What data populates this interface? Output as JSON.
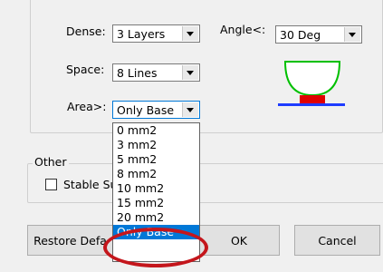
{
  "settings": {
    "dense": {
      "label": "Dense:",
      "value": "3 Layers"
    },
    "angle": {
      "label": "Angle<:",
      "value": "30 Deg"
    },
    "space": {
      "label": "Space:",
      "value": "8 Lines"
    },
    "area": {
      "label": "Area>:",
      "value": "Only Base"
    }
  },
  "area_dropdown": {
    "options": [
      "0 mm2",
      "3 mm2",
      "5 mm2",
      "8 mm2",
      "10 mm2",
      "15 mm2",
      "20 mm2",
      "Only Base"
    ],
    "selected_index": 7
  },
  "other": {
    "title": "Other",
    "stable_support": {
      "label": "Stable Su",
      "checked": false
    }
  },
  "buttons": {
    "restore": "Restore Defa",
    "ok": "OK",
    "cancel": "Cancel"
  },
  "colors": {
    "preview_support": "#00c000",
    "preview_base": "#e00000",
    "preview_plate": "#1e3cff",
    "annotation": "#c4161c",
    "selection": "#0078d7"
  }
}
